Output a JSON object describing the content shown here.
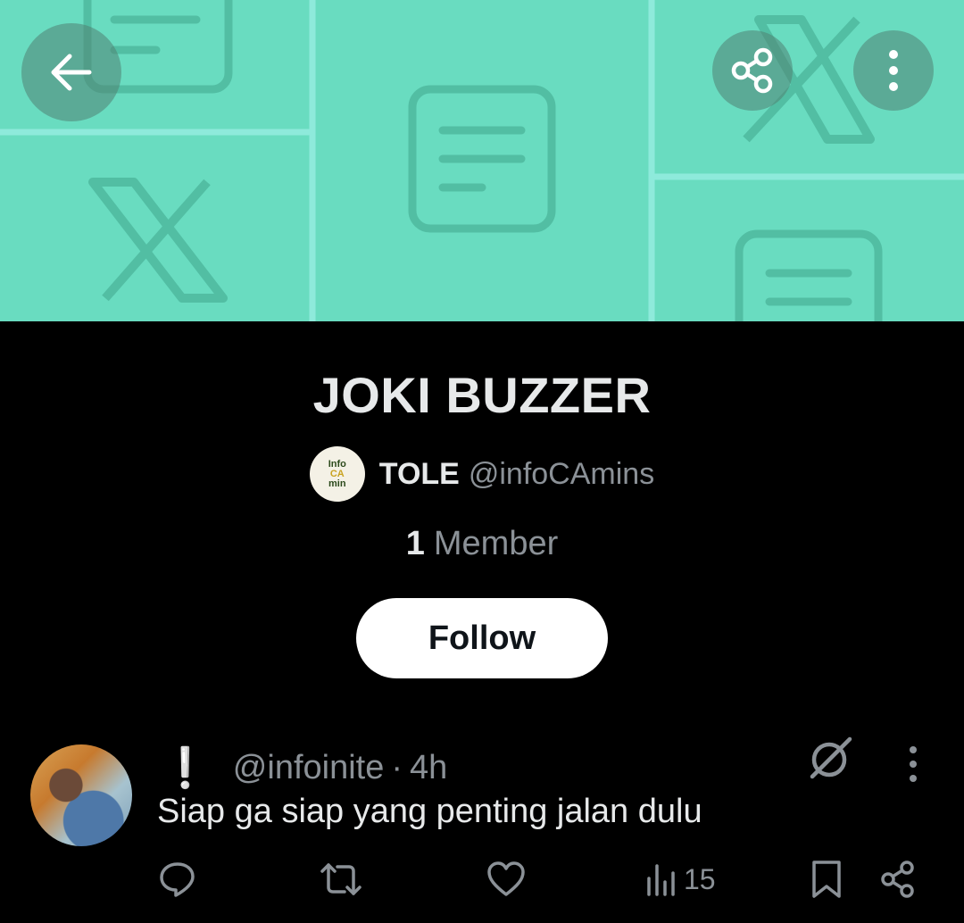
{
  "community": {
    "name": "JOKI BUZZER",
    "owner_display_name": "TOLE",
    "owner_handle": "@infoCAmins",
    "owner_avatar_text": [
      "Info",
      "CA",
      "min"
    ],
    "member_count": "1",
    "member_label": "Member",
    "follow_label": "Follow"
  },
  "banner": {
    "background_color": "#69dcc0",
    "icons": [
      "document-icon",
      "x-logo-icon"
    ]
  },
  "toolbar": {
    "back_icon": "arrow-left-icon",
    "share_icon": "share-icon",
    "more_icon": "more-vertical-icon"
  },
  "post": {
    "badge": "❕",
    "handle": "@infoinite",
    "separator": "·",
    "time": "4h",
    "text": "Siap ga siap yang penting jalan dulu",
    "views": "15",
    "actions": [
      "reply-icon",
      "repost-icon",
      "like-icon",
      "views-icon",
      "bookmark-icon",
      "share-icon"
    ]
  }
}
